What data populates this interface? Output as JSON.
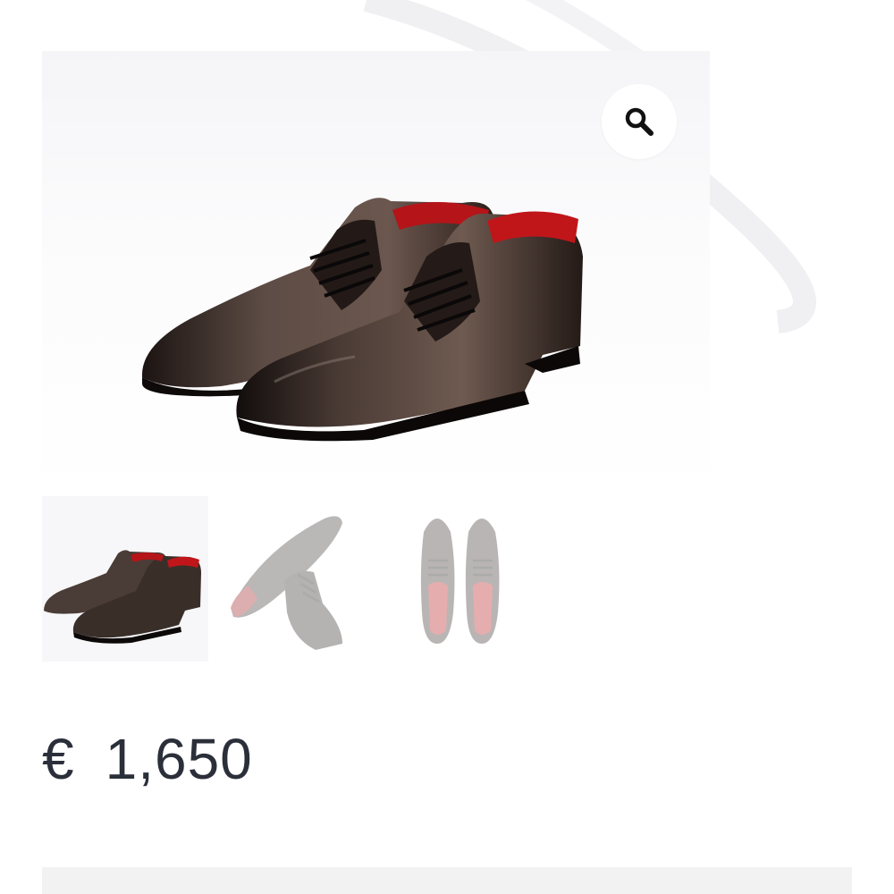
{
  "product": {
    "main_image_icon": "oxford-shoes-pair-image",
    "thumbnails": [
      {
        "icon": "shoes-side-view-thumbnail",
        "selected": true
      },
      {
        "icon": "shoes-sole-view-thumbnail",
        "selected": false
      },
      {
        "icon": "shoes-top-view-thumbnail",
        "selected": false
      }
    ],
    "zoom_icon": "magnifier-icon",
    "price": {
      "currency": "€",
      "amount": "1,650"
    }
  },
  "colors": {
    "price_text": "#2b2f3a",
    "leather_dark": "#2a1f1c",
    "leather_brown": "#5a4a43",
    "lining_red": "#c0161a"
  }
}
